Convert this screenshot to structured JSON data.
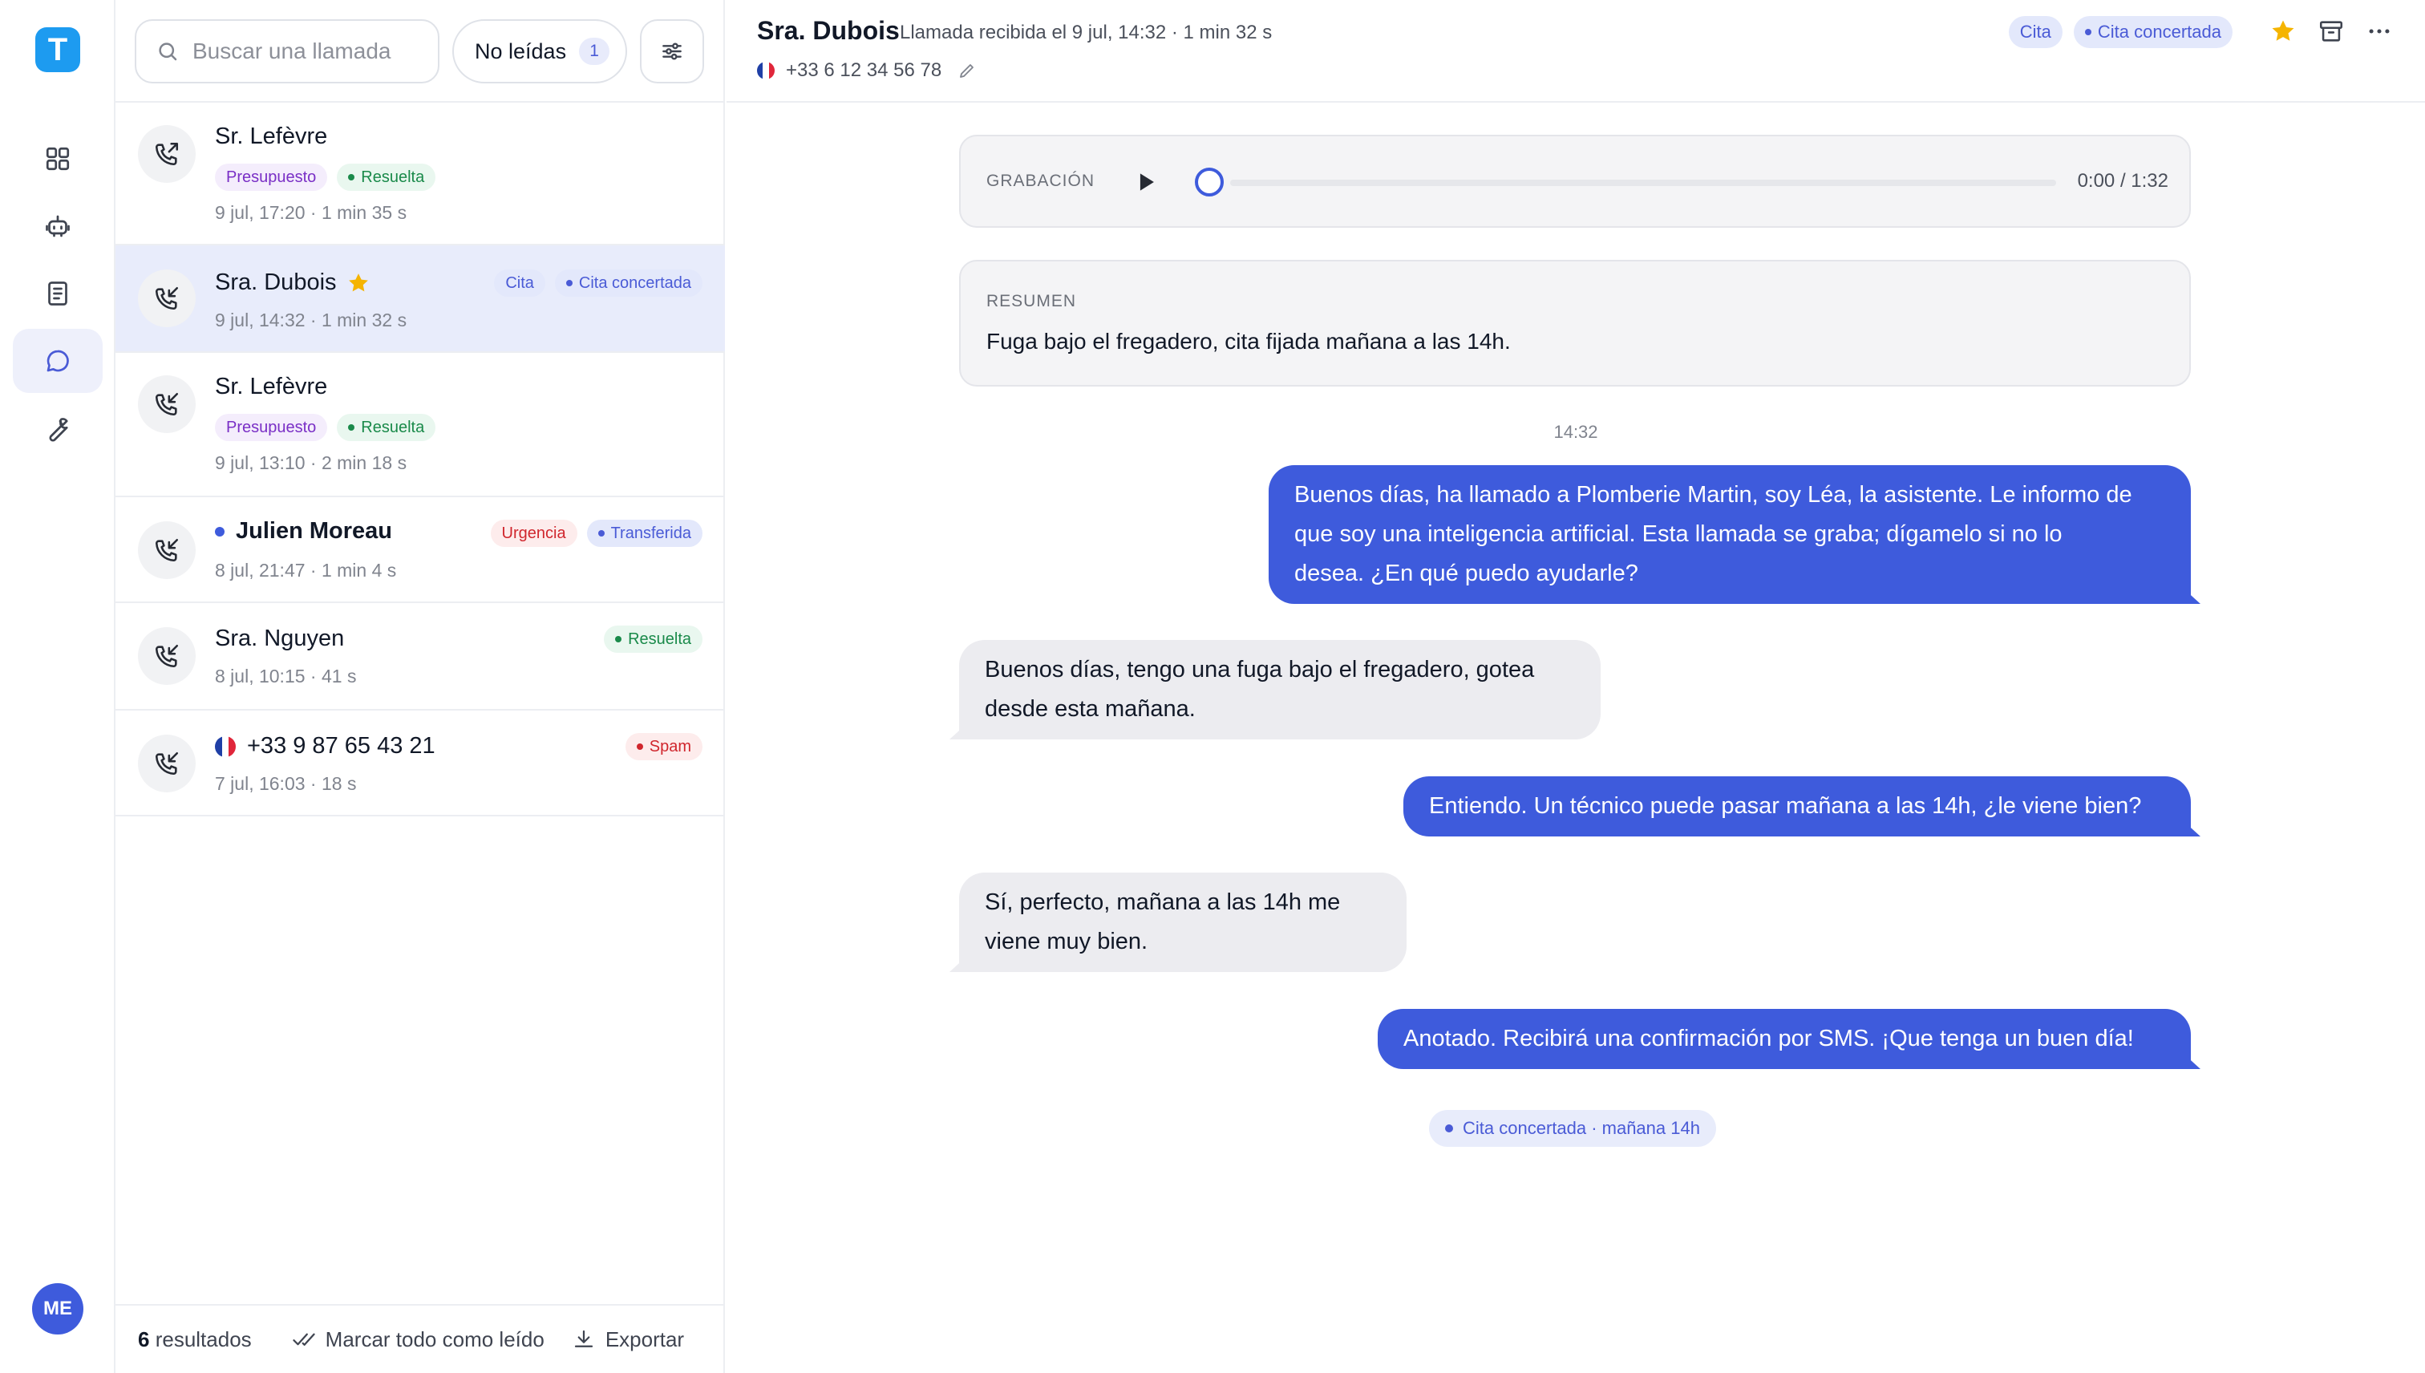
{
  "app": {
    "logo_letter": "T",
    "user_initials": "ME"
  },
  "nav": {
    "items": [
      {
        "name": "dashboard",
        "icon": "grid-icon",
        "active": false
      },
      {
        "name": "assistant",
        "icon": "robot-icon",
        "active": false
      },
      {
        "name": "knowledge",
        "icon": "book-icon",
        "active": false
      },
      {
        "name": "conversations",
        "icon": "chat-bubble-icon",
        "active": true
      },
      {
        "name": "tools",
        "icon": "wrench-icon",
        "active": false
      }
    ]
  },
  "list": {
    "search_placeholder": "Buscar una llamada",
    "unread_filter": {
      "label": "No leídas",
      "count": "1"
    },
    "rows": [
      {
        "name": "Sr. Lefèvre",
        "direction": "outgoing",
        "tags": [
          {
            "label": "Presupuesto"
          },
          {
            "label": "Resuelta"
          }
        ],
        "meta": "9 jul, 17:20 · 1 min 35 s"
      },
      {
        "name": "Sra. Dubois",
        "direction": "incoming",
        "starred": true,
        "selected": true,
        "tags": [
          {
            "label": "Cita"
          },
          {
            "label": "Cita concertada"
          }
        ],
        "meta": "9 jul, 14:32 · 1 min 32 s"
      },
      {
        "name": "Sr. Lefèvre",
        "direction": "incoming",
        "tags": [
          {
            "label": "Presupuesto"
          },
          {
            "label": "Resuelta"
          }
        ],
        "meta": "9 jul, 13:10 · 2 min 18 s"
      },
      {
        "name": "Julien Moreau",
        "direction": "incoming",
        "unread": true,
        "tags": [
          {
            "label": "Urgencia"
          },
          {
            "label": "Transferida"
          }
        ],
        "meta": "8 jul, 21:47 · 1 min 4 s"
      },
      {
        "name": "Sra. Nguyen",
        "direction": "incoming",
        "tags": [
          {
            "label": "Resuelta"
          }
        ],
        "meta": "8 jul, 10:15 · 41 s"
      },
      {
        "name": "+33 9 87 65 43 21",
        "direction": "incoming",
        "flag": "fr",
        "tags": [
          {
            "label": "Spam"
          }
        ],
        "meta": "7 jul, 16:03 · 18 s"
      }
    ],
    "footer": {
      "count": "6",
      "count_suffix": "resultados",
      "mark_all": "Marcar todo como leído",
      "export": "Exportar"
    }
  },
  "detail": {
    "name": "Sra. Dubois",
    "subtitle": "Llamada recibida el 9 jul, 14:32 · 1 min 32 s",
    "phone": "+33 6 12 34 56 78",
    "tags": [
      {
        "label": "Cita"
      },
      {
        "label": "Cita concertada"
      }
    ],
    "recording": {
      "label": "GRABACIÓN",
      "time": "0:00 / 1:32",
      "progress": 0
    },
    "summary": {
      "label": "RESUMEN",
      "text": "Fuga bajo el fregadero, cita fijada mañana a las 14h."
    },
    "time_separator": "14:32",
    "messages": [
      {
        "from": "agent",
        "lines": [
          "Buenos días, ha llamado a Plomberie Martin, soy Léa, la asistente. Le informo de",
          "que soy una inteligencia artificial. Esta llamada se graba; dígamelo si no lo",
          "desea. ¿En qué puedo ayudarle?"
        ]
      },
      {
        "from": "caller",
        "lines": [
          "Buenos días, tengo una fuga bajo el fregadero, gotea",
          "desde esta mañana."
        ]
      },
      {
        "from": "agent",
        "lines": [
          "Entiendo. Un técnico puede pasar mañana a las 14h, ¿le viene bien?"
        ]
      },
      {
        "from": "caller",
        "lines": [
          "Sí, perfecto, mañana a las 14h me",
          "viene muy bien."
        ]
      },
      {
        "from": "agent",
        "lines": [
          "Anotado. Recibirá una confirmación por SMS. ¡Que tenga un buen día!"
        ]
      }
    ],
    "outcome": "Cita concertada · mañana 14h"
  },
  "colors": {
    "accent": "#3e5bdc",
    "agent_bubble": "#3e5bdc",
    "caller_bubble": "#ececf0",
    "selected_row": "#e8ecfb",
    "tag_purple": "#7a2fc6",
    "tag_green": "#1a8a4a",
    "tag_blue": "#4a5bd6",
    "tag_red": "#d0262d",
    "star": "#f5b400"
  }
}
